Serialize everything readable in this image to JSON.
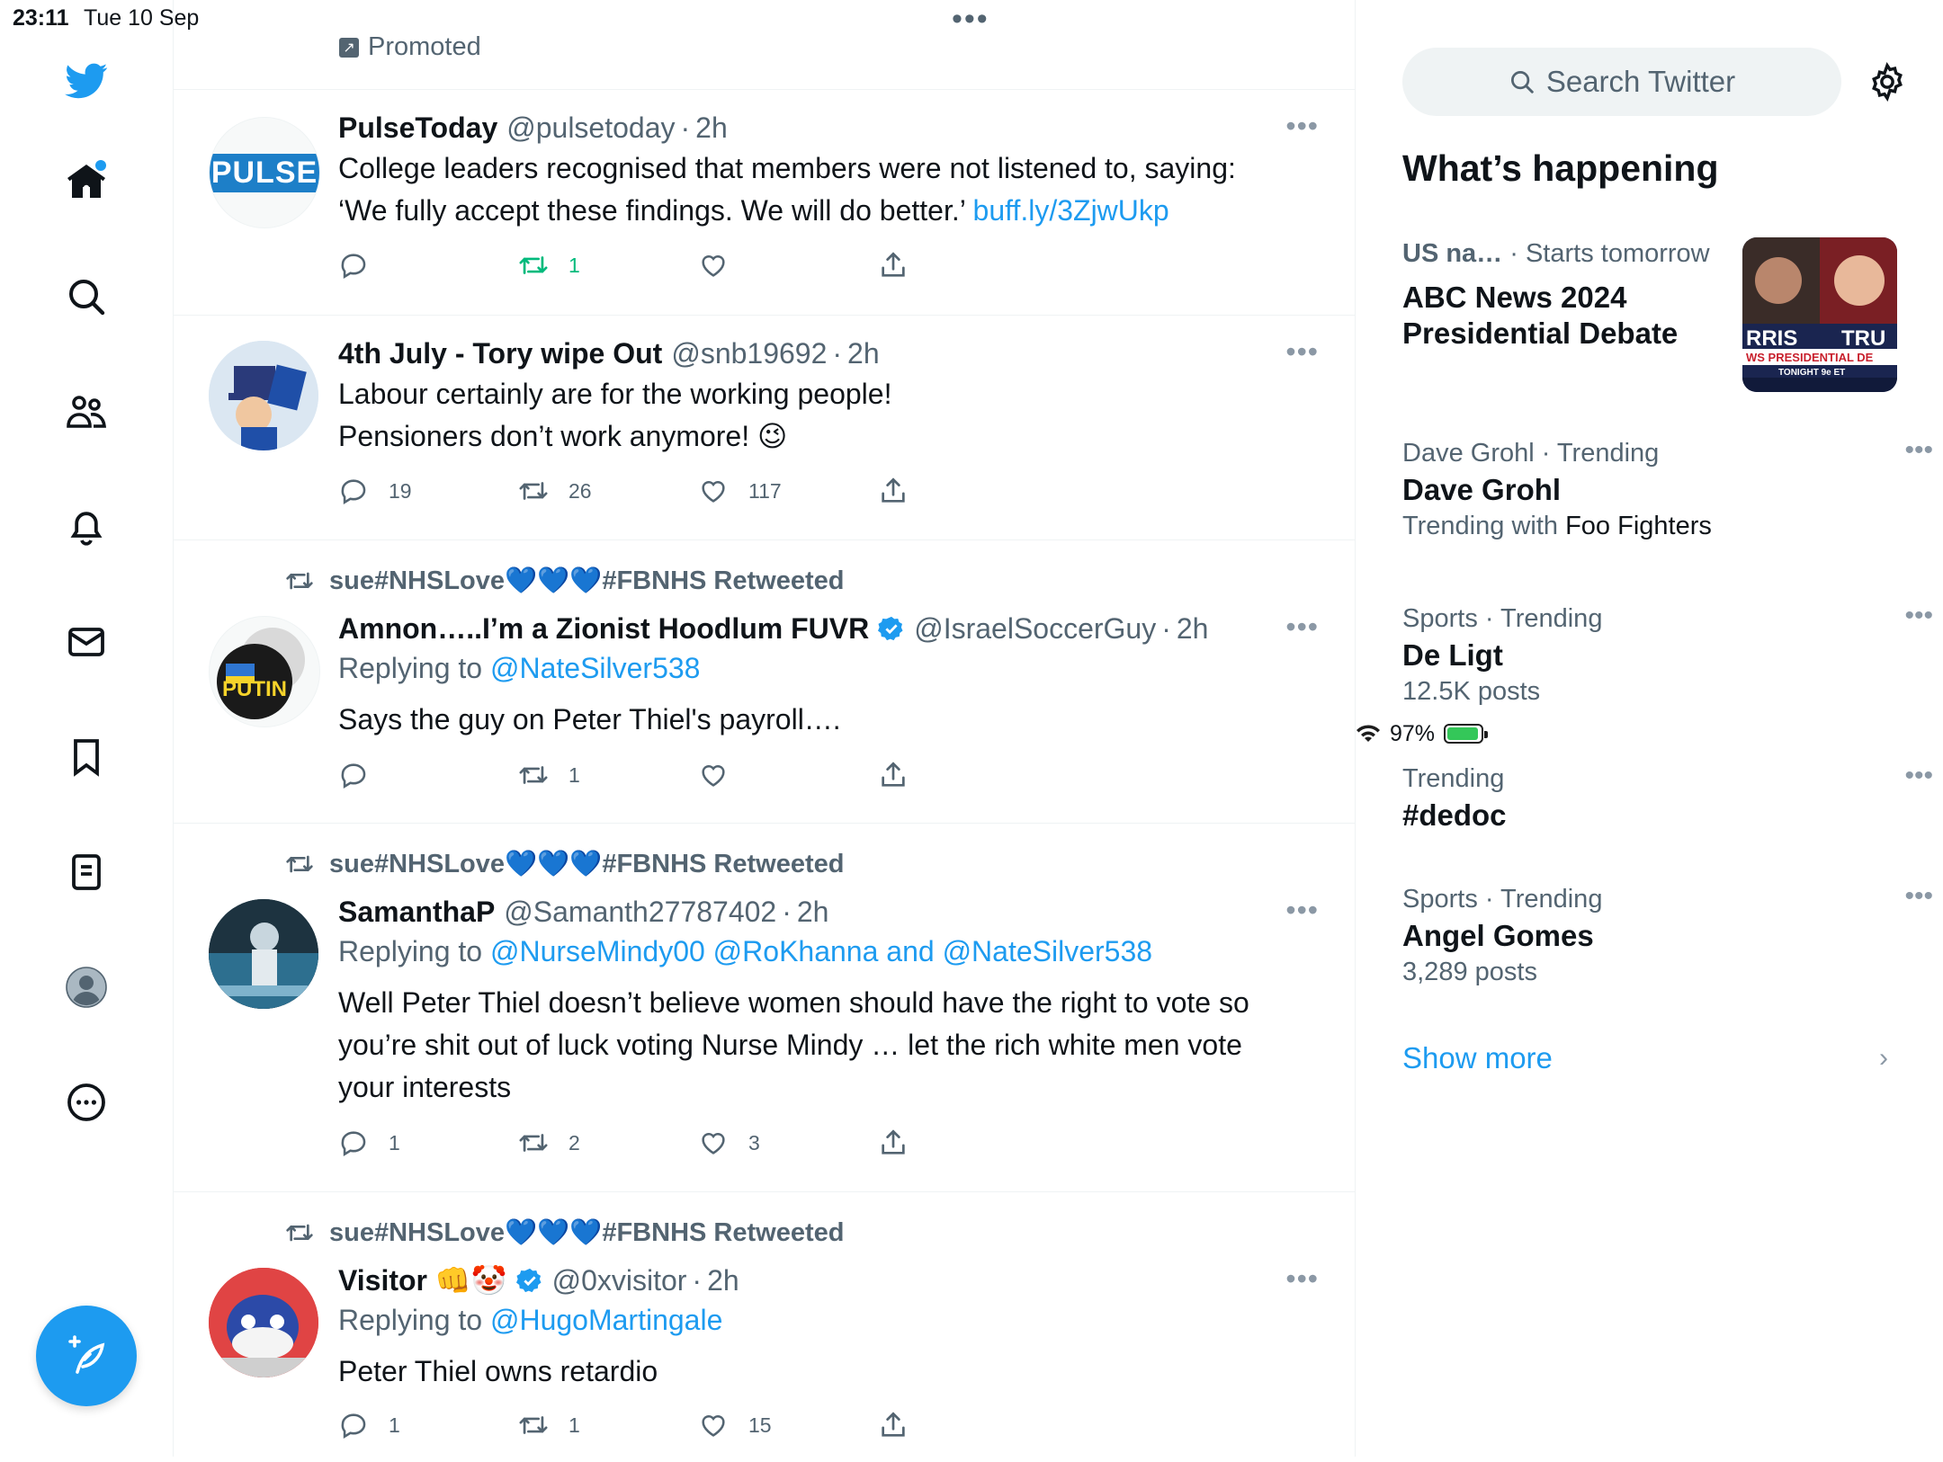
{
  "status_bar": {
    "time": "23:11",
    "date": "Tue 10 Sep",
    "battery": "97%",
    "more": "•••"
  },
  "nav": [
    "Twitter",
    "Home",
    "Explore",
    "Communities",
    "Notifications",
    "Messages",
    "Bookmarks",
    "Lists",
    "Profile",
    "More"
  ],
  "timeline": {
    "promoted_label": "Promoted",
    "tweets": [
      {
        "name": "PulseToday",
        "handle": "@pulsetoday",
        "time": "2h",
        "text_lines": [
          "College leaders recognised that members were not listened to, saying:",
          "‘We fully accept these findings. We will do better.’ "
        ],
        "link": "buff.ly/3ZjwUkp",
        "avatar_text": "PULSE",
        "retweets": "1",
        "replies": "",
        "likes": ""
      },
      {
        "name": "4th July - Tory wipe Out",
        "handle": "@snb19692",
        "time": "2h",
        "text_lines": [
          "Labour certainly are for the working people!",
          "Pensioners don’t work anymore! 😉"
        ],
        "replies": "19",
        "retweets": "26",
        "likes": "117"
      },
      {
        "retweeted_by": "sue#NHSLove💙💙💙#FBNHS Retweeted",
        "name": "Amnon…..I’m a Zionist Hoodlum FUVR",
        "handle": "@IsraelSoccerGuy",
        "time": "2h",
        "replying_prefix": "Replying to ",
        "replying_to": "@NateSilver538",
        "text": "Says the guy on Peter Thiel's payroll….",
        "avatar_text": "PUTIN",
        "replies": "",
        "retweets": "1",
        "likes": ""
      },
      {
        "retweeted_by": "sue#NHSLove💙💙💙#FBNHS Retweeted",
        "name": "SamanthaP",
        "handle": "@Samanth27787402",
        "time": "2h",
        "replying_prefix": "Replying to ",
        "replying_to": "@NurseMindy00 @RoKhanna and @NateSilver538",
        "text_lines": [
          "Well Peter Thiel doesn’t believe women should have the right to vote so",
          "you’re shit out of luck voting Nurse Mindy … let the rich white men vote",
          "your interests"
        ],
        "replies": "1",
        "retweets": "2",
        "likes": "3"
      },
      {
        "retweeted_by": "sue#NHSLove💙💙💙#FBNHS Retweeted",
        "name": "Visitor 👊🤡",
        "handle": "@0xvisitor",
        "time": "2h",
        "replying_prefix": "Replying to ",
        "replying_to": "@HugoMartingale",
        "text": "Peter Thiel owns retardio",
        "replies": "1",
        "retweets": "1",
        "likes": "15"
      }
    ]
  },
  "sidebar": {
    "search_placeholder": "Search Twitter",
    "whats_happening": "What’s happening",
    "news": {
      "source": "US na…",
      "when": "· Starts tomorrow",
      "title_lines": [
        "ABC News 2024",
        "Presidential Debate"
      ],
      "image_text_left": "RRIS",
      "image_text_right": "TRU",
      "image_banner": "WS PRESIDENTIAL DE",
      "image_tonight": "TONIGHT 9e ET"
    },
    "trends": [
      {
        "meta": "Dave Grohl · Trending",
        "title": "Dave Grohl",
        "sub_prefix": "Trending with ",
        "sub_emph": "Foo Fighters"
      },
      {
        "meta": "Sports · Trending",
        "title": "De Ligt",
        "sub": "12.5K posts"
      },
      {
        "meta": "Trending",
        "title": "#dedoc"
      },
      {
        "meta": "Sports · Trending",
        "title": "Angel Gomes",
        "sub": "3,289 posts"
      }
    ],
    "show_more": "Show more"
  },
  "colors": {
    "accent": "#1d9bf0",
    "muted": "#536471",
    "retweet_green": "#00ba7c"
  }
}
